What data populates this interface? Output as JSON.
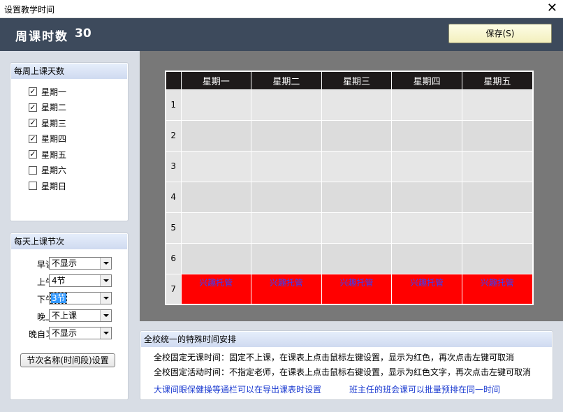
{
  "window": {
    "title": "设置教学时间",
    "close_glyph": "✕"
  },
  "header": {
    "label": "周课时数",
    "count": "30",
    "save_label": "保存(S)"
  },
  "days": {
    "title": "每周上课天数",
    "items": [
      {
        "label": "星期一",
        "checked": true
      },
      {
        "label": "星期二",
        "checked": true
      },
      {
        "label": "星期三",
        "checked": true
      },
      {
        "label": "星期四",
        "checked": true
      },
      {
        "label": "星期五",
        "checked": true
      },
      {
        "label": "星期六",
        "checked": false
      },
      {
        "label": "星期日",
        "checked": false
      }
    ]
  },
  "periods": {
    "title": "每天上课节次",
    "rows": [
      {
        "label": "早读",
        "value": "不显示"
      },
      {
        "label": "上午",
        "value": "4节"
      },
      {
        "label": "下午",
        "value": "3节"
      },
      {
        "label": "晚上",
        "value": "不上课"
      },
      {
        "label": "晚自习",
        "value": "不显示"
      }
    ],
    "names_button": "节次名称(时间段)设置"
  },
  "timetable": {
    "columns": [
      "星期一",
      "星期二",
      "星期三",
      "星期四",
      "星期五"
    ],
    "rows": [
      "1",
      "2",
      "3",
      "4",
      "5",
      "6",
      "7"
    ],
    "row7_text": "兴趣托管",
    "colors": {
      "header_bg": "#1e1a1a",
      "marked_cell": "#ff0000",
      "marked_text": "#3040ff"
    }
  },
  "info": {
    "title": "全校统一的特殊时间安排",
    "line1": "全校固定无课时间：固定不上课，在课表上点击鼠标左键设置，显示为红色，再次点击左键可取消",
    "line2": "全校固定活动时间：不指定老师，在课表上点击鼠标右键设置，显示为红色文字，再次点击左键可取消",
    "link1": "大课间眼保健操等通栏可以在导出课表时设置",
    "link2": "班主任的班会课可以批量预排在同一时间"
  }
}
